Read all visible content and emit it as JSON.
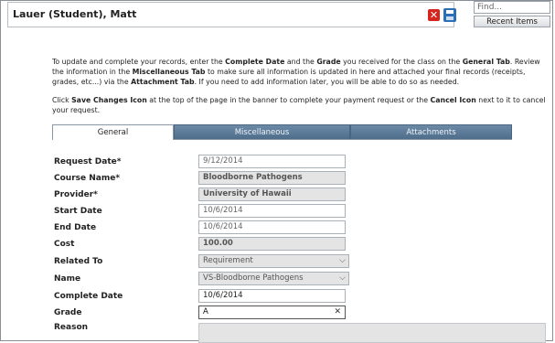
{
  "header": {
    "title": "Lauer (Student), Matt",
    "cancel_icon": "cancel-x-icon",
    "save_icon": "floppy-disk-icon"
  },
  "search": {
    "placeholder": "Find...",
    "recent_items_label": "Recent Items"
  },
  "instructions": {
    "p1": "To update and complete your records, enter the Complete Date and the Grade you received for the class on the General Tab.  Review the information in the Miscellaneous Tab to make sure all information is updated in here and attached your final records (receipts, grades, etc...) via the Attachment Tab.  If you need to add information later, you will be able to do so as needed.",
    "p2": "Click Save Changes Icon at the top of the page in the banner to complete your payment request or the Cancel Icon next to it to cancel your request."
  },
  "tabs": [
    {
      "label": "General",
      "active": true
    },
    {
      "label": "Miscellaneous",
      "active": false
    },
    {
      "label": "Attachments",
      "active": false
    }
  ],
  "form": {
    "request_date": {
      "label": "Request Date*",
      "value": "9/12/2014"
    },
    "course_name": {
      "label": "Course Name*",
      "value": "Bloodborne Pathogens"
    },
    "provider": {
      "label": "Provider*",
      "value": "University of Hawaii"
    },
    "start_date": {
      "label": "Start Date",
      "value": "10/6/2014"
    },
    "end_date": {
      "label": "End Date",
      "value": "10/6/2014"
    },
    "cost": {
      "label": "Cost",
      "value": "100.00"
    },
    "related_to": {
      "label": "Related To",
      "value": "Requirement"
    },
    "name": {
      "label": "Name",
      "value": "VS-Bloodborne Pathogens"
    },
    "complete_date": {
      "label": "Complete Date",
      "value": "10/6/2014"
    },
    "grade": {
      "label": "Grade",
      "value": "A"
    },
    "reason": {
      "label": "Reason",
      "value": ""
    }
  },
  "colors": {
    "tab_inactive": "#5a7a98",
    "cancel_red": "#d6241f",
    "save_blue": "#2d6fb7"
  }
}
